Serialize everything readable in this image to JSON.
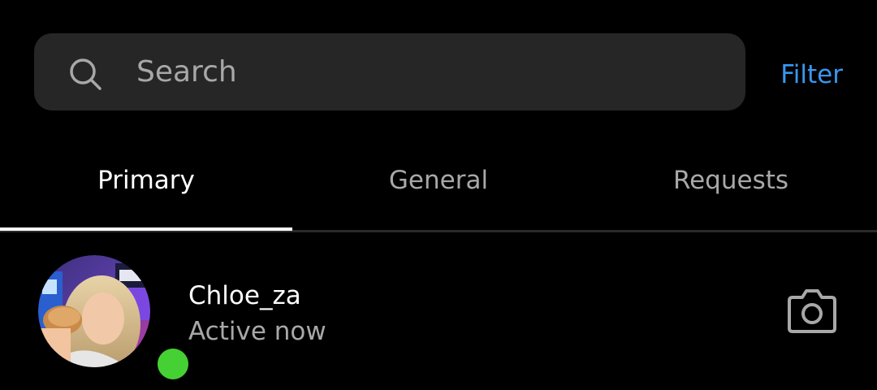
{
  "search": {
    "placeholder": "Search",
    "value": "",
    "icon": "search-icon"
  },
  "filter_label": "Filter",
  "colors": {
    "background": "#000000",
    "search_bg": "#262626",
    "accent": "#3897f0",
    "text_primary": "#ffffff",
    "text_secondary": "#a8a8a8",
    "online": "#45d134"
  },
  "tabs": [
    {
      "label": "Primary",
      "active": true
    },
    {
      "label": "General",
      "active": false
    },
    {
      "label": "Requests",
      "active": false
    }
  ],
  "conversations": [
    {
      "username": "Chloe_za",
      "status": "Active now",
      "online": true,
      "action_icon": "camera-icon"
    }
  ]
}
